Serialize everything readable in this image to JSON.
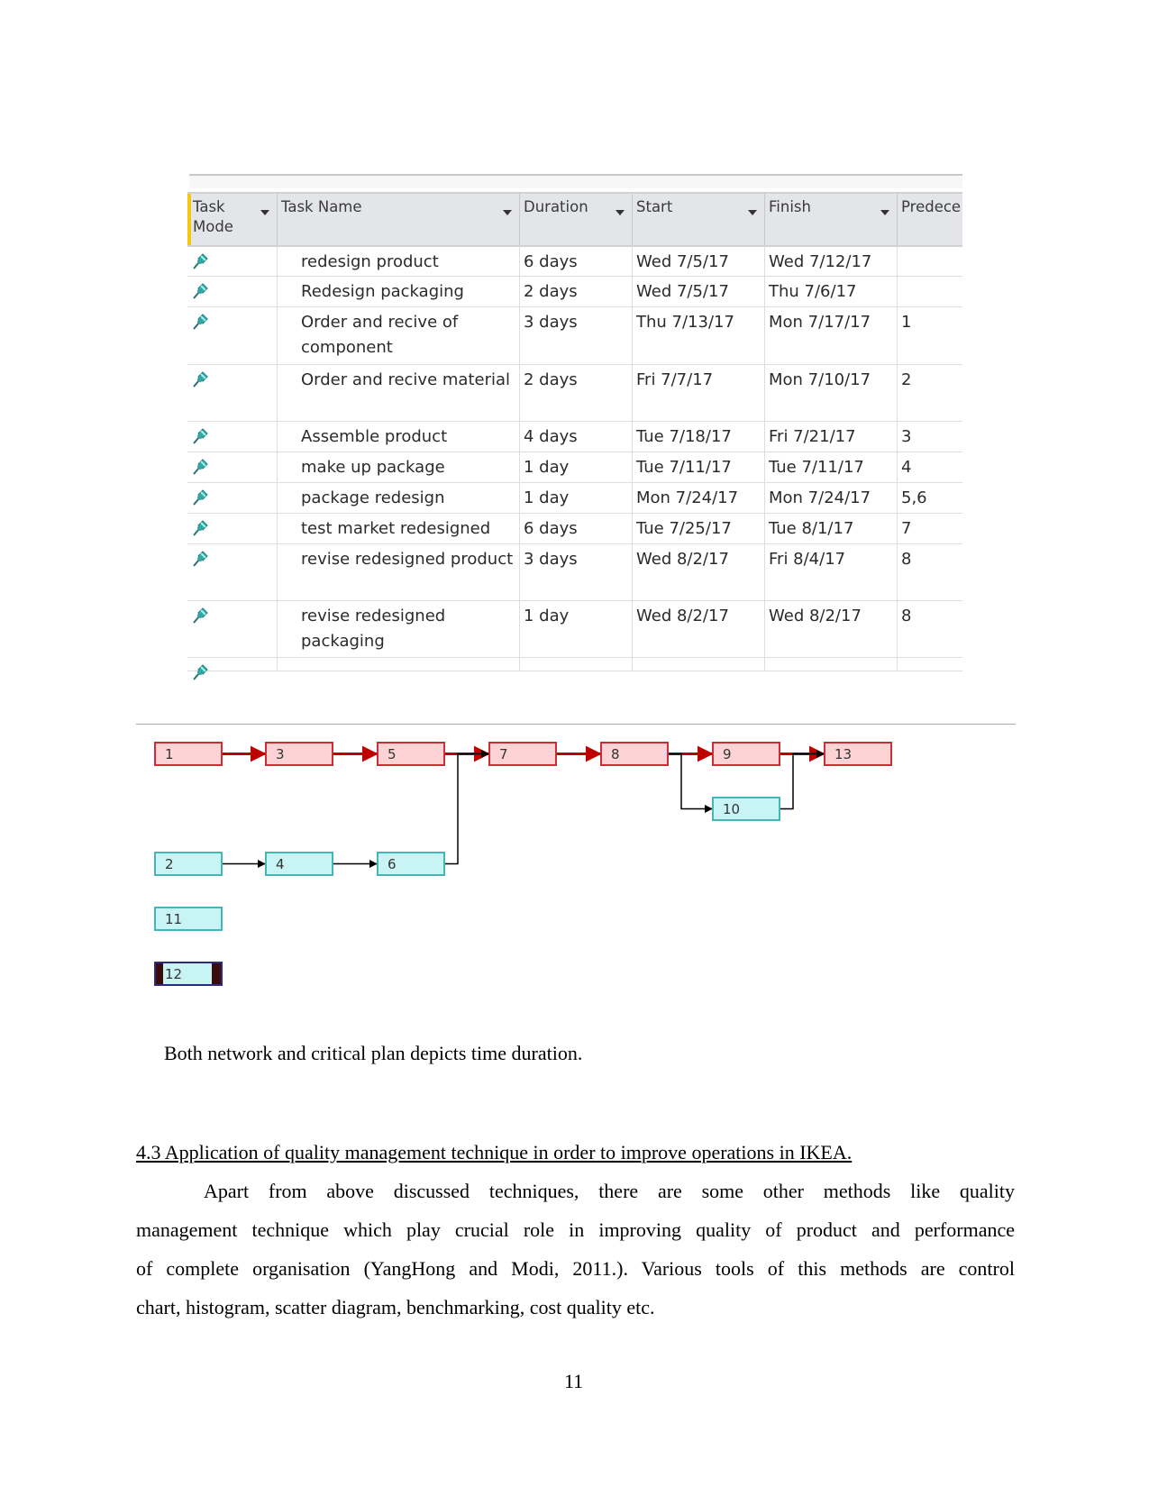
{
  "table": {
    "columns": [
      {
        "label": "Task Mode",
        "dropdown": true
      },
      {
        "label": "Task Name",
        "dropdown": true
      },
      {
        "label": "Duration",
        "dropdown": true
      },
      {
        "label": "Start",
        "dropdown": true
      },
      {
        "label": "Finish",
        "dropdown": true
      },
      {
        "label": "Predece",
        "dropdown": false
      }
    ],
    "mode_icon": "pushpin-icon",
    "rows": [
      {
        "name": "redesign product",
        "duration": "6 days",
        "start": "Wed 7/5/17",
        "finish": "Wed 7/12/17",
        "pred": ""
      },
      {
        "name": "Redesign packaging",
        "duration": "2 days",
        "start": "Wed 7/5/17",
        "finish": "Thu 7/6/17",
        "pred": ""
      },
      {
        "name": "Order and recive of component",
        "duration": "3 days",
        "start": "Thu 7/13/17",
        "finish": "Mon 7/17/17",
        "pred": "1"
      },
      {
        "name": "Order and recive material",
        "duration": "2 days",
        "start": "Fri 7/7/17",
        "finish": "Mon 7/10/17",
        "pred": "2"
      },
      {
        "name": "Assemble product",
        "duration": "4 days",
        "start": "Tue 7/18/17",
        "finish": "Fri 7/21/17",
        "pred": "3"
      },
      {
        "name": "make up package",
        "duration": "1 day",
        "start": "Tue 7/11/17",
        "finish": "Tue 7/11/17",
        "pred": "4"
      },
      {
        "name": "package redesign",
        "duration": "1 day",
        "start": "Mon 7/24/17",
        "finish": "Mon 7/24/17",
        "pred": "5,6"
      },
      {
        "name": "test market redesigned",
        "duration": "6 days",
        "start": "Tue 7/25/17",
        "finish": "Tue 8/1/17",
        "pred": "7"
      },
      {
        "name": "revise redesigned product",
        "duration": "3 days",
        "start": "Wed 8/2/17",
        "finish": "Fri 8/4/17",
        "pred": "8"
      },
      {
        "name": "revise redesigned packaging",
        "duration": "1 day",
        "start": "Wed 8/2/17",
        "finish": "Wed 8/2/17",
        "pred": "8"
      },
      {
        "name": "",
        "duration": "",
        "start": "",
        "finish": "",
        "pred": ""
      }
    ]
  },
  "network": {
    "colors": {
      "critical_fill": "#fdd3d5",
      "critical_border": "#cf2d35",
      "normal_fill": "#c8f4f6",
      "normal_border": "#45b6b8",
      "critical_link": "#c00000",
      "normal_link": "#000000"
    },
    "nodes": [
      {
        "id": "1",
        "type": "critical"
      },
      {
        "id": "3",
        "type": "critical"
      },
      {
        "id": "5",
        "type": "critical"
      },
      {
        "id": "7",
        "type": "critical"
      },
      {
        "id": "8",
        "type": "critical"
      },
      {
        "id": "9",
        "type": "critical"
      },
      {
        "id": "13",
        "type": "critical"
      },
      {
        "id": "10",
        "type": "normal"
      },
      {
        "id": "2",
        "type": "normal"
      },
      {
        "id": "4",
        "type": "normal"
      },
      {
        "id": "6",
        "type": "normal"
      },
      {
        "id": "11",
        "type": "normal"
      },
      {
        "id": "12",
        "type": "selected"
      }
    ],
    "links": [
      {
        "from": "1",
        "to": "3",
        "critical": true
      },
      {
        "from": "3",
        "to": "5",
        "critical": true
      },
      {
        "from": "5",
        "to": "7",
        "critical": true
      },
      {
        "from": "6",
        "to": "7",
        "critical": false
      },
      {
        "from": "7",
        "to": "8",
        "critical": true
      },
      {
        "from": "8",
        "to": "9",
        "critical": true
      },
      {
        "from": "8",
        "to": "10",
        "critical": false
      },
      {
        "from": "9",
        "to": "13",
        "critical": true
      },
      {
        "from": "10",
        "to": "13",
        "critical": false
      },
      {
        "from": "2",
        "to": "4",
        "critical": false
      },
      {
        "from": "4",
        "to": "6",
        "critical": false
      }
    ]
  },
  "text": {
    "caption": "Both network and critical plan depicts time duration.",
    "heading": "4.3 Application of quality management technique in order to improve operations in IKEA.",
    "paragraph_lines": [
      "Apart from above discussed techniques, there are some other methods like quality",
      "management technique which play crucial role in improving quality of product and performance",
      "of complete organisation (YangHong and Modi, 2011.). Various tools of this methods are control",
      "chart, histogram, scatter diagram, benchmarking, cost quality etc."
    ],
    "page_number": "11"
  }
}
